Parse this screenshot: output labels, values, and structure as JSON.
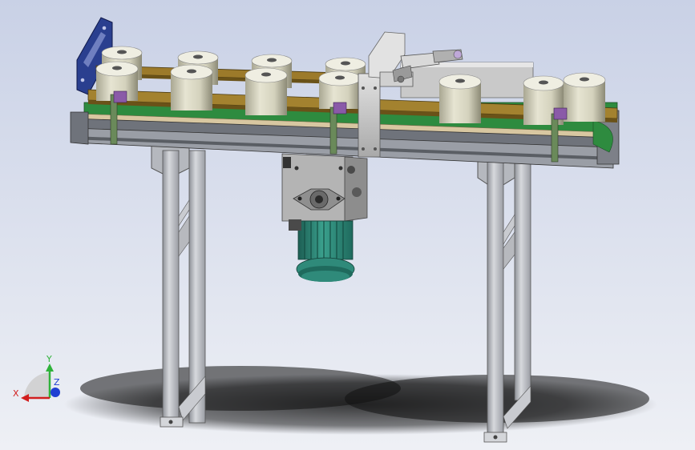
{
  "view": {
    "background_top": "#c9d1e6",
    "background_bottom": "#eef0f5"
  },
  "colors": {
    "frame": "#b9bcc2",
    "frame_dark": "#6f737b",
    "belt": "#2e8b3f",
    "rail": "#9c7a2a",
    "roll": "#d9d7c4",
    "motor": "#2f8a7a",
    "side_plate": "#2a3f8f",
    "cover": "#c8c8c8",
    "clamp": "#8a5aa8"
  },
  "triad": {
    "x_label": "X",
    "y_label": "Y",
    "z_label": "Z",
    "x_color": "#d21f1f",
    "y_color": "#2fb23a",
    "z_color": "#1f3fd2"
  }
}
